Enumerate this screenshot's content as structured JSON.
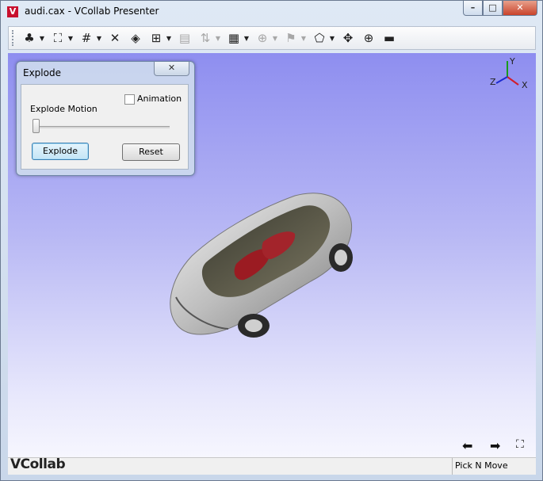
{
  "window": {
    "icon_letter": "V",
    "title": "audi.cax - VCollab Presenter",
    "controls": {
      "minimize": "–",
      "maximize": "□",
      "close": "✕"
    }
  },
  "toolbar": {
    "buttons": [
      {
        "name": "tree-icon",
        "glyph": "♣",
        "dropdown": true,
        "enabled": true
      },
      {
        "name": "fit-view-icon",
        "glyph": "⛶",
        "dropdown": true,
        "enabled": true
      },
      {
        "name": "section-grid-icon",
        "glyph": "#",
        "dropdown": true,
        "enabled": true
      },
      {
        "name": "explode-icon",
        "glyph": "✕",
        "dropdown": false,
        "enabled": true
      },
      {
        "name": "display-mode-icon",
        "glyph": "◈",
        "dropdown": false,
        "enabled": true
      },
      {
        "name": "transform-icon",
        "glyph": "⊞",
        "dropdown": true,
        "enabled": true
      },
      {
        "name": "film-icon",
        "glyph": "▤",
        "dropdown": false,
        "enabled": false
      },
      {
        "name": "sort-icon",
        "glyph": "⇅",
        "dropdown": true,
        "enabled": false
      },
      {
        "name": "contour-legend-icon",
        "glyph": "▦",
        "dropdown": true,
        "enabled": true
      },
      {
        "name": "probe-icon",
        "glyph": "⊕",
        "dropdown": true,
        "enabled": false
      },
      {
        "name": "flag-icon",
        "glyph": "⚑",
        "dropdown": true,
        "enabled": false
      },
      {
        "name": "note-icon",
        "glyph": "⬠",
        "dropdown": true,
        "enabled": true
      },
      {
        "name": "move-icon",
        "glyph": "✥",
        "dropdown": false,
        "enabled": true
      },
      {
        "name": "zoom-window-icon",
        "glyph": "⊕",
        "dropdown": false,
        "enabled": true
      },
      {
        "name": "scale-bar-icon",
        "glyph": "▬",
        "dropdown": false,
        "enabled": true
      }
    ]
  },
  "explode_dialog": {
    "title": "Explode",
    "close_label": "✕",
    "animation_label": "Animation",
    "animation_checked": false,
    "motion_label": "Explode Motion",
    "slider_value": 0,
    "explode_button": "Explode",
    "reset_button": "Reset"
  },
  "axis_triad": {
    "y": "Y",
    "z": "Z",
    "x": "X"
  },
  "navigation": {
    "prev": "⬅",
    "next": "➡",
    "fullscreen": "⛶"
  },
  "status": {
    "logo": "VCollab",
    "mode": "Pick N Move"
  },
  "colors": {
    "viewport_top": "#8e8ef0",
    "viewport_bottom": "#f6f6fe",
    "accent_red": "#c8102e"
  }
}
